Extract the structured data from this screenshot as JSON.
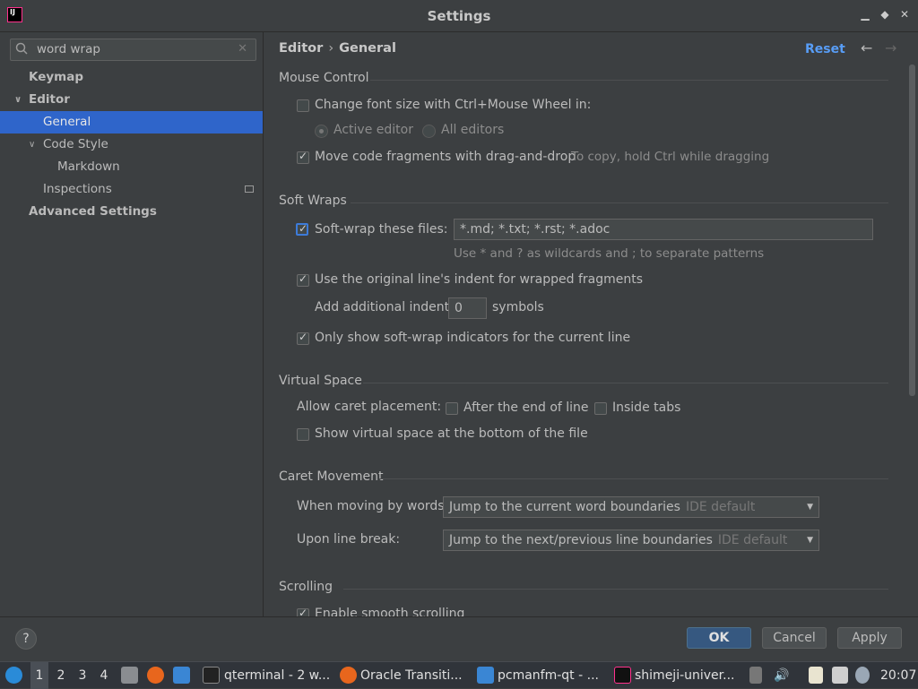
{
  "window": {
    "title": "Settings",
    "app_icon_text": "IJ"
  },
  "sidebar": {
    "search_value": "word wrap",
    "items": [
      {
        "label": "Keymap"
      },
      {
        "label": "Editor"
      },
      {
        "label": "General"
      },
      {
        "label": "Code Style"
      },
      {
        "label": "Markdown"
      },
      {
        "label": "Inspections"
      },
      {
        "label": "Advanced Settings"
      }
    ]
  },
  "breadcrumb": {
    "parent": "Editor",
    "sep": "›",
    "current": "General"
  },
  "header": {
    "reset_label": "Reset"
  },
  "mouse_control": {
    "title": "Mouse Control",
    "font_size_wheel": "Change font size with Ctrl+Mouse Wheel in:",
    "active_editor": "Active editor",
    "all_editors": "All editors",
    "move_fragments": "Move code fragments with drag-and-drop",
    "move_hint": "To copy, hold Ctrl while dragging"
  },
  "soft_wraps": {
    "title": "Soft Wraps",
    "files_label": "Soft-wrap these files:",
    "files_value": "*.md; *.txt; *.rst; *.adoc",
    "files_hint": "Use * and ? as wildcards and ; to separate patterns",
    "original_indent": "Use the original line's indent for wrapped fragments",
    "additional_indent_label": "Add additional indent:",
    "additional_indent_value": "0",
    "symbols_label": "symbols",
    "indicators_current_line": "Only show soft-wrap indicators for the current line"
  },
  "virtual_space": {
    "title": "Virtual Space",
    "caret_placement_label": "Allow caret placement:",
    "after_end_of_line": "After the end of line",
    "inside_tabs": "Inside tabs",
    "show_bottom": "Show virtual space at the bottom of the file"
  },
  "caret_movement": {
    "title": "Caret Movement",
    "moving_by_words_label": "When moving by words:",
    "moving_by_words_value": "Jump to the current word boundaries",
    "moving_by_words_default": "IDE default",
    "line_break_label": "Upon line break:",
    "line_break_value": "Jump to the next/previous line boundaries",
    "line_break_default": "IDE default"
  },
  "scrolling": {
    "title": "Scrolling",
    "smooth": "Enable smooth scrolling"
  },
  "footer": {
    "help": "?",
    "ok": "OK",
    "cancel": "Cancel",
    "apply": "Apply"
  },
  "taskbar": {
    "workspaces": [
      "1",
      "2",
      "3",
      "4"
    ],
    "tasks": [
      {
        "label": "qterminal - 2 w..."
      },
      {
        "label": "Oracle Transiti..."
      },
      {
        "label": "pcmanfm-qt - ..."
      },
      {
        "label": "shimeji-univer..."
      }
    ],
    "clock": "20:07"
  }
}
